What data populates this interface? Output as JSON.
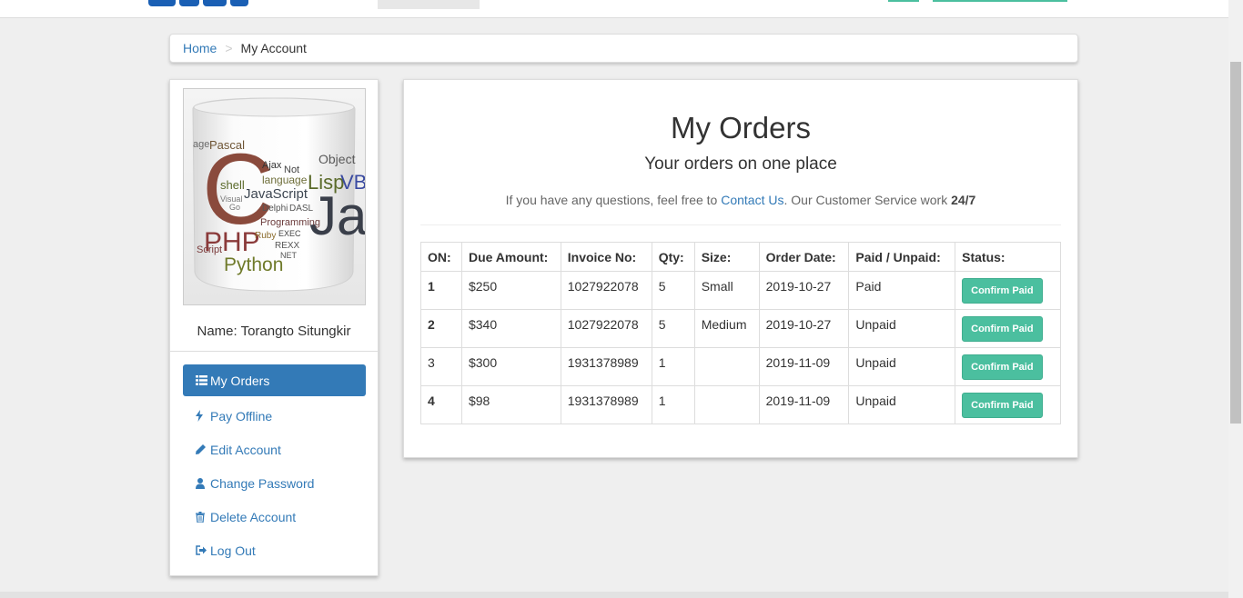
{
  "breadcrumb": {
    "home": "Home",
    "separator": ">",
    "current": "My Account"
  },
  "profile": {
    "name_label": "Name: Torangto Situngkir",
    "mug_words": [
      "C",
      "Java",
      "PHP",
      "Python",
      "Pascal",
      "JavaScript",
      "Lisp",
      "VB",
      "Object",
      "language",
      "shell",
      "Ajax",
      "Delphi",
      "DASL",
      "Programming",
      "Ruby",
      "EXEC",
      "REXX",
      "Visual",
      "Go",
      "NET",
      "Not",
      "Script",
      "age"
    ]
  },
  "sidebar": {
    "items": [
      {
        "label": "My Orders",
        "icon": "list-icon",
        "active": true
      },
      {
        "label": "Pay Offline",
        "icon": "bolt-icon",
        "active": false
      },
      {
        "label": "Edit Account",
        "icon": "pencil-icon",
        "active": false
      },
      {
        "label": "Change Password",
        "icon": "user-icon",
        "active": false
      },
      {
        "label": "Delete Account",
        "icon": "trash-icon",
        "active": false
      },
      {
        "label": "Log Out",
        "icon": "logout-icon",
        "active": false
      }
    ]
  },
  "main": {
    "title": "My Orders",
    "subtitle": "Your orders on one place",
    "info_prefix": "If you have any questions, feel free to ",
    "info_link": "Contact Us",
    "info_middle": ". Our Customer Service work ",
    "info_bold": "24/7"
  },
  "orders": {
    "headers": [
      "ON:",
      "Due Amount:",
      "Invoice No:",
      "Qty:",
      "Size:",
      "Order Date:",
      "Paid / Unpaid:",
      "Status:"
    ],
    "rows": [
      {
        "on": "1",
        "amount": "$250",
        "invoice": "1027922078",
        "qty": "5",
        "size": "Small",
        "date": "2019-10-27",
        "paid": "Paid",
        "action": "Confirm Paid",
        "bold_on": true
      },
      {
        "on": "2",
        "amount": "$340",
        "invoice": "1027922078",
        "qty": "5",
        "size": "Medium",
        "date": "2019-10-27",
        "paid": "Unpaid",
        "action": "Confirm Paid",
        "bold_on": true
      },
      {
        "on": "3",
        "amount": "$300",
        "invoice": "1931378989",
        "qty": "1",
        "size": "",
        "date": "2019-11-09",
        "paid": "Unpaid",
        "action": "Confirm Paid",
        "bold_on": false
      },
      {
        "on": "4",
        "amount": "$98",
        "invoice": "1931378989",
        "qty": "1",
        "size": "",
        "date": "2019-11-09",
        "paid": "Unpaid",
        "action": "Confirm Paid",
        "bold_on": true
      }
    ]
  },
  "colors": {
    "primary": "#337ab7",
    "success": "#4bbf9f",
    "background": "#efefef"
  }
}
